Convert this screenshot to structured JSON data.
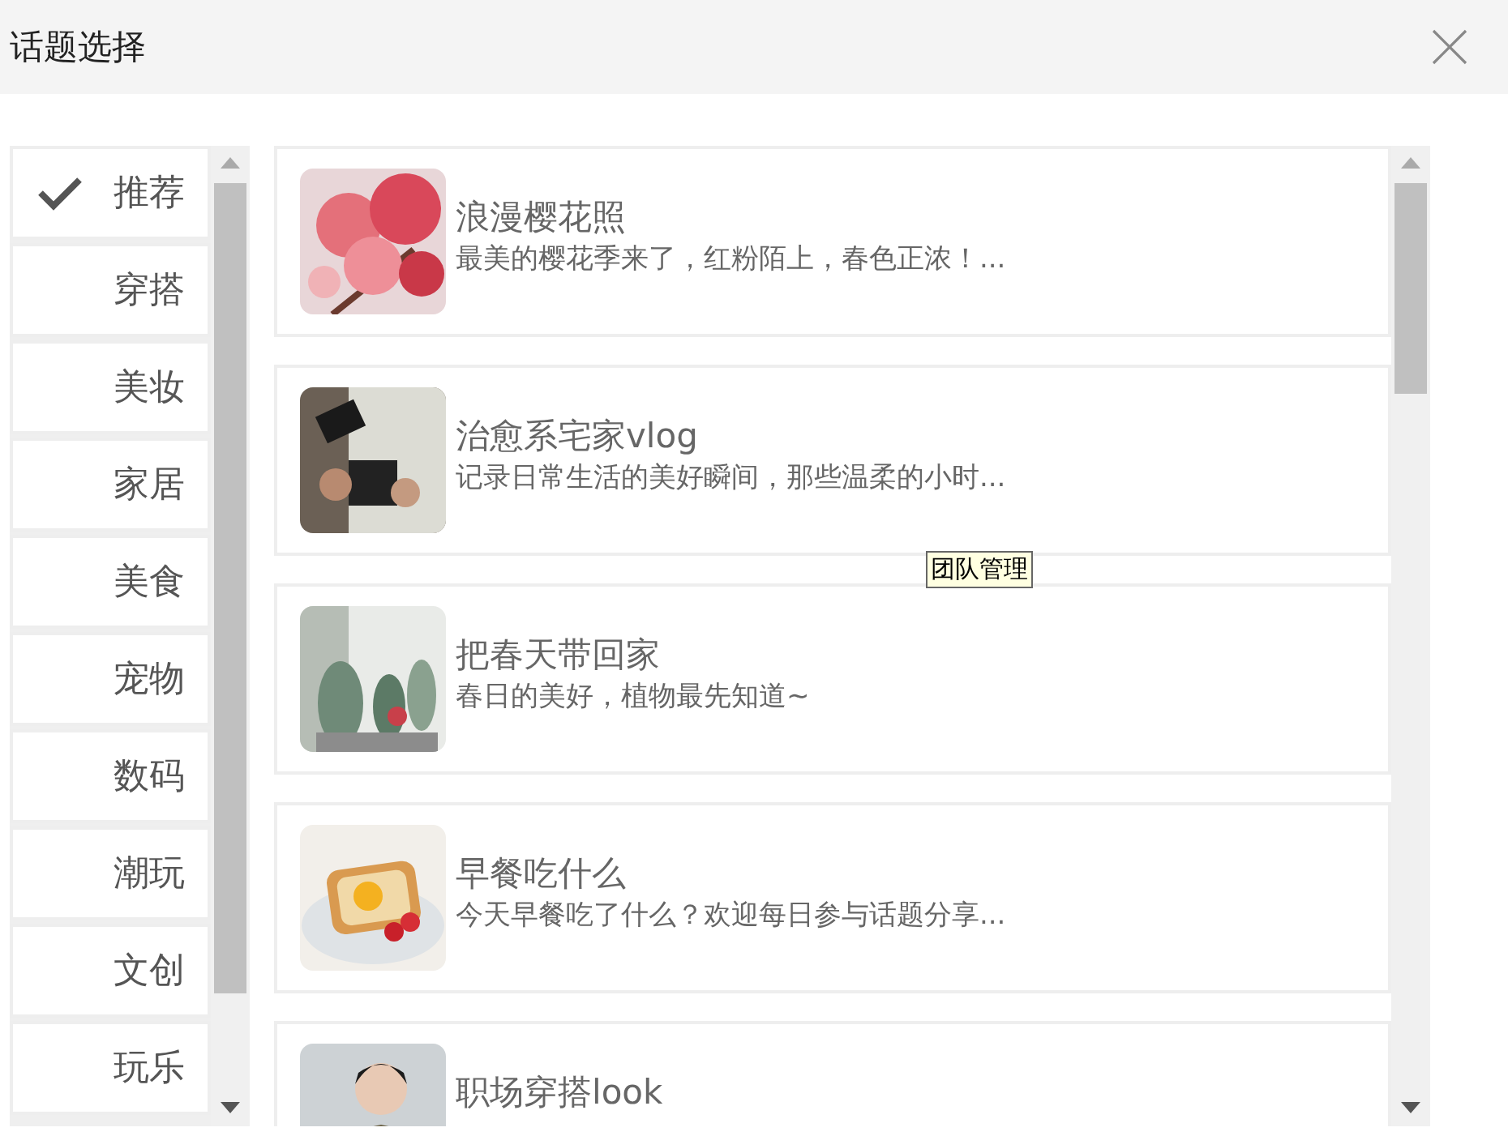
{
  "window": {
    "title": "话题选择"
  },
  "categories": [
    {
      "label": "推荐",
      "selected": true
    },
    {
      "label": "穿搭",
      "selected": false
    },
    {
      "label": "美妆",
      "selected": false
    },
    {
      "label": "家居",
      "selected": false
    },
    {
      "label": "美食",
      "selected": false
    },
    {
      "label": "宠物",
      "selected": false
    },
    {
      "label": "数码",
      "selected": false
    },
    {
      "label": "潮玩",
      "selected": false
    },
    {
      "label": "文创",
      "selected": false
    },
    {
      "label": "玩乐",
      "selected": false
    }
  ],
  "topics": [
    {
      "title": "浪漫樱花照",
      "description": "最美的樱花季来了，红粉陌上，春色正浓！..."
    },
    {
      "title": "治愈系宅家vlog",
      "description": "记录日常生活的美好瞬间，那些温柔的小时..."
    },
    {
      "title": "把春天带回家",
      "description": "春日的美好，植物最先知道~"
    },
    {
      "title": "早餐吃什么",
      "description": "今天早餐吃了什么？欢迎每日参与话题分享..."
    },
    {
      "title": "职场穿搭look"
    }
  ],
  "tooltip": "团队管理"
}
